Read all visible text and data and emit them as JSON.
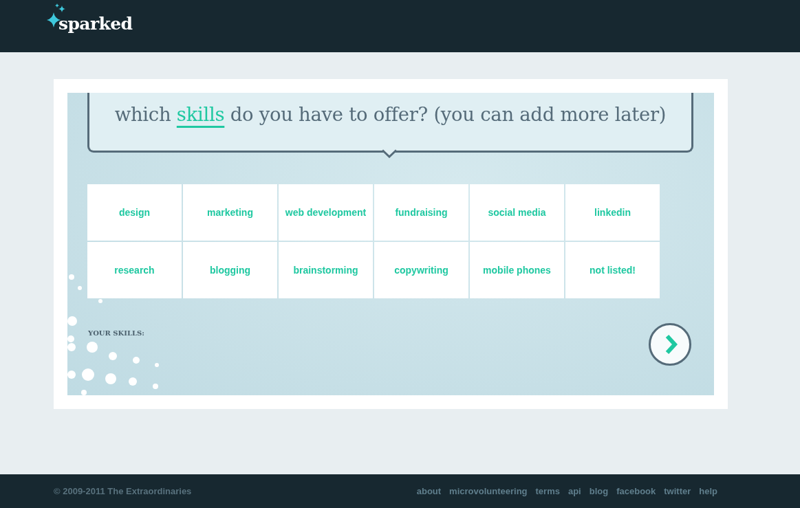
{
  "header": {
    "logo": "sparked"
  },
  "question": "which *skills* do you have to offer? (you can add more later)",
  "skills": [
    {
      "label": "design",
      "selected": false
    },
    {
      "label": "marketing",
      "selected": false
    },
    {
      "label": "web development",
      "selected": false
    },
    {
      "label": "fundraising",
      "selected": false
    },
    {
      "label": "social media",
      "selected": false
    },
    {
      "label": "linkedin",
      "selected": false
    },
    {
      "label": "research",
      "selected": false
    },
    {
      "label": "blogging",
      "selected": false
    },
    {
      "label": "brainstorming",
      "selected": false
    },
    {
      "label": "copywriting",
      "selected": false
    },
    {
      "label": "mobile phones",
      "selected": false
    },
    {
      "label": "not listed!",
      "selected": false
    }
  ],
  "your_skills": {
    "label": "YOUR SKILLS:"
  },
  "footer": {
    "copyright": "© 2009-2011 The Extraordinaries",
    "links": [
      "about",
      "microvolunteering",
      "terms",
      "api",
      "blog",
      "facebook",
      "twitter",
      "help"
    ]
  }
}
